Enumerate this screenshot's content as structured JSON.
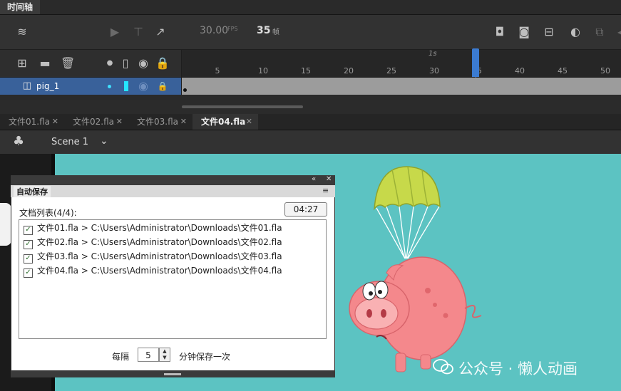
{
  "timeline": {
    "title": "时间轴",
    "fps_value": "30.00",
    "fps_unit": "FPS",
    "current_frame": "35",
    "frame_unit": "帧",
    "second_marker": "1s",
    "ruler_numbers": [
      "5",
      "10",
      "15",
      "20",
      "25",
      "30",
      "35",
      "40",
      "45",
      "50"
    ],
    "layer_name": "pig_1"
  },
  "doc_tabs": [
    {
      "label": "文件01.fla",
      "active": false
    },
    {
      "label": "文件02.fla",
      "active": false
    },
    {
      "label": "文件03.fla",
      "active": false
    },
    {
      "label": "文件04.fla",
      "active": true
    }
  ],
  "scene": {
    "label": "Scene 1"
  },
  "autosave": {
    "title": "自动保存",
    "list_label": "文档列表(4/4):",
    "timer": "04:27",
    "items": [
      "文件01.fla > C:\\Users\\Administrator\\Downloads\\文件01.fla",
      "文件02.fla > C:\\Users\\Administrator\\Downloads\\文件02.fla",
      "文件03.fla > C:\\Users\\Administrator\\Downloads\\文件03.fla",
      "文件04.fla > C:\\Users\\Administrator\\Downloads\\文件04.fla"
    ],
    "interval_prefix": "每隔",
    "interval_value": "5",
    "interval_suffix": "分钟保存一次"
  },
  "watermark": "公众号 · 懒人动画",
  "colors": {
    "stage": "#5cc3c2",
    "selected_layer": "#39619a",
    "playhead": "#3b7bd1"
  }
}
